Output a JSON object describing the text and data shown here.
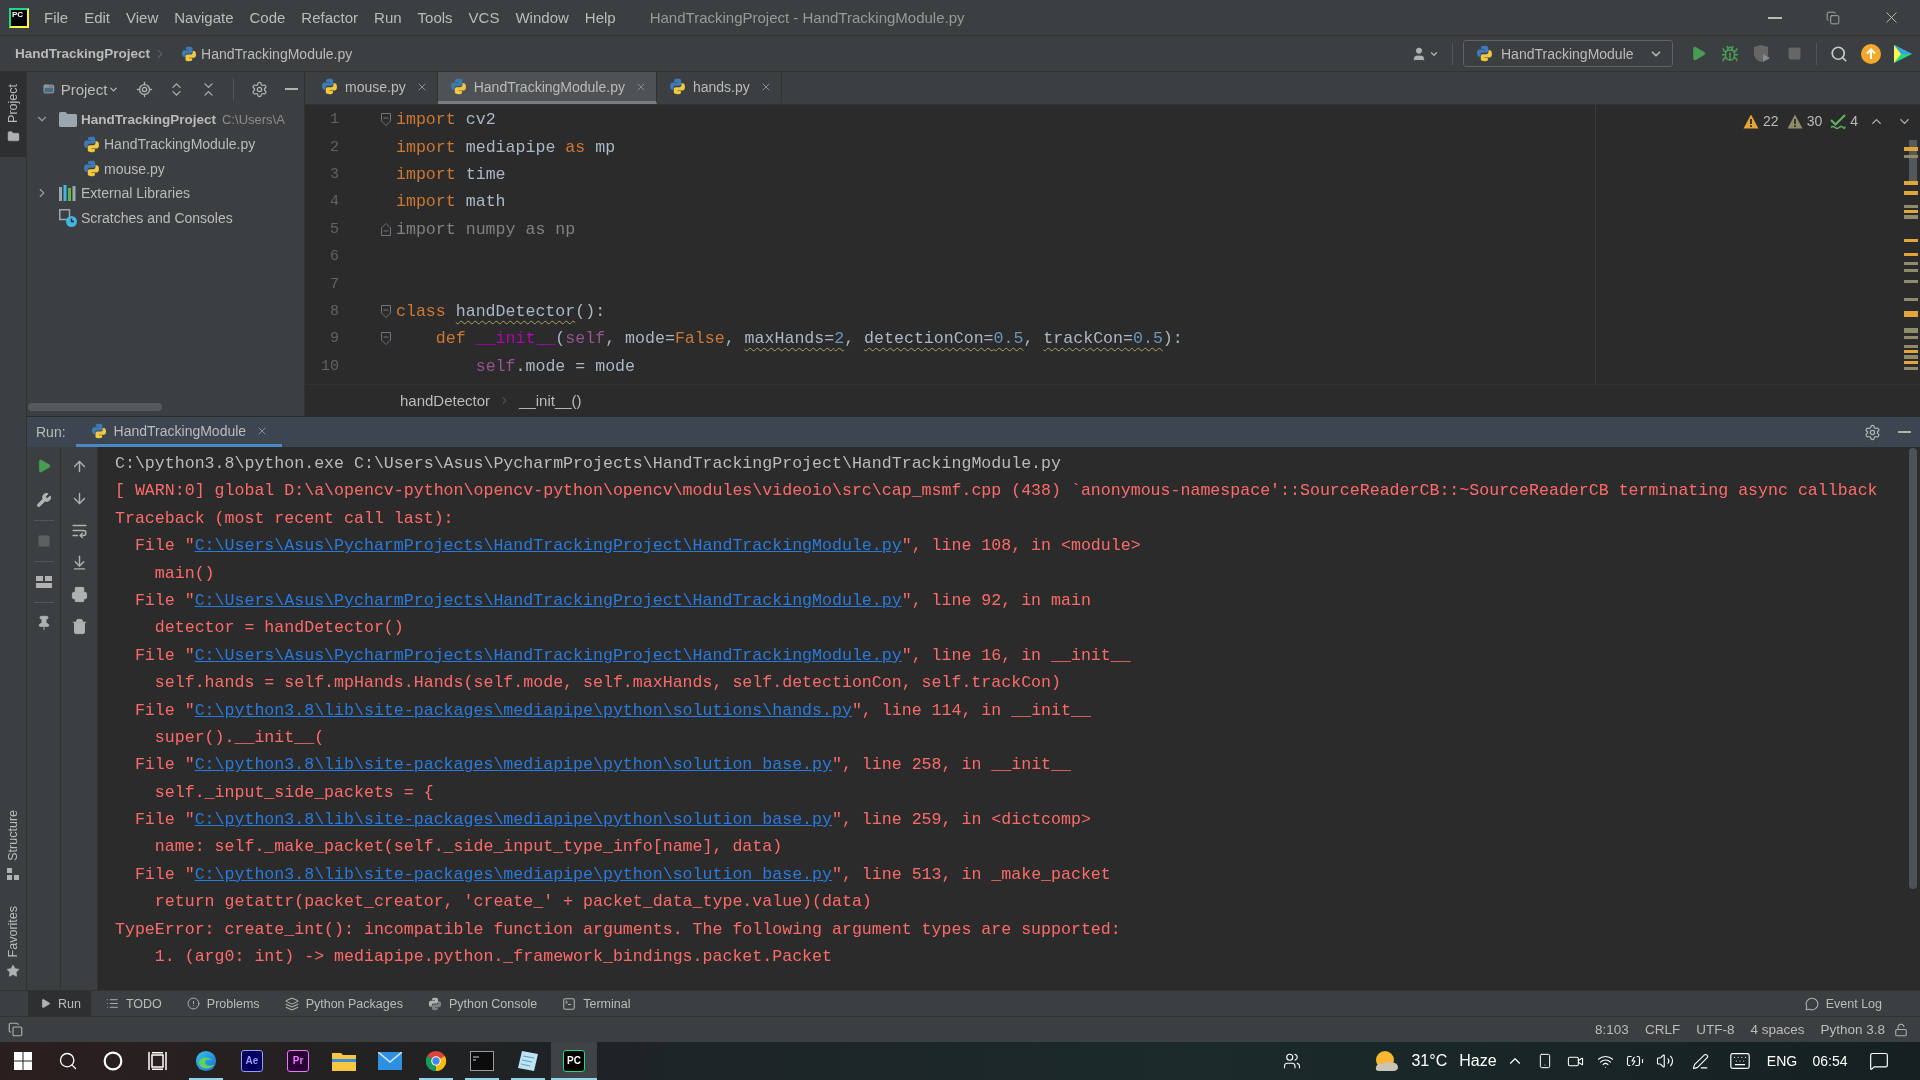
{
  "window": {
    "app_logo": "PC",
    "title": "HandTrackingProject - HandTrackingModule.py"
  },
  "menu": [
    "File",
    "Edit",
    "View",
    "Navigate",
    "Code",
    "Refactor",
    "Run",
    "Tools",
    "VCS",
    "Window",
    "Help"
  ],
  "navigation": {
    "project": "HandTrackingProject",
    "file": "HandTrackingModule.py",
    "run_configuration": "HandTrackingModule"
  },
  "side_strip": {
    "top": [
      {
        "label": "Project",
        "kind": "project",
        "selected": true
      }
    ],
    "bottom": [
      {
        "label": "Structure",
        "kind": "structure",
        "selected": false
      },
      {
        "label": "Favorites",
        "kind": "favorites",
        "selected": false
      }
    ]
  },
  "project_panel": {
    "title": "Project",
    "tree": [
      {
        "name": "HandTrackingProject",
        "path": "C:\\Users\\A",
        "kind": "project",
        "expanded": true,
        "children": [
          {
            "name": "HandTrackingModule.py",
            "kind": "python"
          },
          {
            "name": "mouse.py",
            "kind": "python"
          }
        ]
      },
      {
        "name": "External Libraries",
        "kind": "library",
        "expanded": false
      },
      {
        "name": "Scratches and Consoles",
        "kind": "scratches"
      }
    ]
  },
  "editor_tabs": [
    {
      "label": "mouse.py",
      "selected": false
    },
    {
      "label": "HandTrackingModule.py",
      "selected": true
    },
    {
      "label": "hands.py",
      "selected": false
    }
  ],
  "inspections": [
    {
      "kind": "warning",
      "count": "22"
    },
    {
      "kind": "weak_warning",
      "count": "30"
    },
    {
      "kind": "typo",
      "count": "4"
    }
  ],
  "code": {
    "lines": [
      {
        "number": "1",
        "fold_start": true,
        "fold_end": false,
        "tokens": [
          {
            "text": "import ",
            "kind": "keyword"
          },
          {
            "text": "cv2",
            "kind": "plain"
          }
        ]
      },
      {
        "number": "2",
        "fold_start": false,
        "fold_end": false,
        "tokens": [
          {
            "text": "import ",
            "kind": "keyword"
          },
          {
            "text": "mediapipe ",
            "kind": "plain"
          },
          {
            "text": "as ",
            "kind": "keyword"
          },
          {
            "text": "mp",
            "kind": "plain"
          }
        ]
      },
      {
        "number": "3",
        "fold_start": false,
        "fold_end": false,
        "tokens": [
          {
            "text": "import ",
            "kind": "keyword"
          },
          {
            "text": "time",
            "kind": "plain"
          }
        ]
      },
      {
        "number": "4",
        "fold_start": false,
        "fold_end": false,
        "tokens": [
          {
            "text": "import ",
            "kind": "keyword"
          },
          {
            "text": "math",
            "kind": "plain"
          }
        ]
      },
      {
        "number": "5",
        "fold_start": false,
        "fold_end": true,
        "tokens": [
          {
            "text": "import numpy as np",
            "kind": "unused"
          }
        ]
      },
      {
        "number": "6",
        "fold_start": false,
        "fold_end": false
      },
      {
        "number": "7",
        "fold_start": false,
        "fold_end": false
      },
      {
        "number": "8",
        "fold_start": true,
        "fold_end": false,
        "tokens": [
          {
            "text": "class ",
            "kind": "keyword"
          },
          {
            "text": "handDetector",
            "kind": "warned"
          },
          {
            "text": "():",
            "kind": "plain"
          }
        ],
        "children": [
          {
            "number": "9",
            "fold_start": true,
            "fold_end": false,
            "tokens": [
              {
                "text": "def ",
                "kind": "keyword"
              },
              {
                "text": "__init__",
                "kind": "magic"
              },
              {
                "text": "(",
                "kind": "plain"
              },
              {
                "text": "self",
                "kind": "self"
              },
              {
                "text": ", mode=",
                "kind": "plain"
              },
              {
                "text": "False",
                "kind": "keyword"
              },
              {
                "text": ", ",
                "kind": "plain"
              },
              {
                "text": "maxHands=",
                "kind": "warned"
              },
              {
                "text": "2",
                "kind": "warned_number"
              },
              {
                "text": ", ",
                "kind": "plain"
              },
              {
                "text": "detectionCon=",
                "kind": "warned"
              },
              {
                "text": "0.5",
                "kind": "warned_number"
              },
              {
                "text": ", ",
                "kind": "plain"
              },
              {
                "text": "trackCon=",
                "kind": "warned"
              },
              {
                "text": "0.5",
                "kind": "warned_number"
              },
              {
                "text": "):",
                "kind": "plain"
              }
            ],
            "children": [
              {
                "number": "10",
                "fold_start": false,
                "fold_end": false,
                "tokens": [
                  {
                    "text": "self",
                    "kind": "self"
                  },
                  {
                    "text": ".mode = mode",
                    "kind": "plain"
                  }
                ]
              }
            ]
          }
        ]
      }
    ]
  },
  "editor_breadcrumb": [
    "handDetector",
    "__init__()"
  ],
  "run_panel": {
    "label": "Run:",
    "tabs": [
      {
        "label": "HandTrackingModule",
        "selected": true
      }
    ],
    "console": [
      {
        "kind": "command",
        "text": "C:\\python3.8\\python.exe C:\\Users\\Asus\\PycharmProjects\\HandTrackingProject\\HandTrackingModule.py"
      },
      {
        "kind": "error",
        "text": "[ WARN:0] global D:\\a\\opencv-python\\opencv-python\\opencv\\modules\\videoio\\src\\cap_msmf.cpp (438) `anonymous-namespace'::SourceReaderCB::~SourceReaderCB terminating async callback"
      },
      {
        "kind": "error",
        "text": "Traceback (most recent call last):"
      },
      {
        "kind": "frame",
        "before": "File \"",
        "link": "C:\\Users\\Asus\\PycharmProjects\\HandTrackingProject\\HandTrackingModule.py",
        "after": "\", line 108, in <module>"
      },
      {
        "kind": "source",
        "text": "main()"
      },
      {
        "kind": "frame",
        "before": "File \"",
        "link": "C:\\Users\\Asus\\PycharmProjects\\HandTrackingProject\\HandTrackingModule.py",
        "after": "\", line 92, in main"
      },
      {
        "kind": "source",
        "text": "detector = handDetector()"
      },
      {
        "kind": "frame",
        "before": "File \"",
        "link": "C:\\Users\\Asus\\PycharmProjects\\HandTrackingProject\\HandTrackingModule.py",
        "after": "\", line 16, in __init__"
      },
      {
        "kind": "source",
        "text": "self.hands = self.mpHands.Hands(self.mode, self.maxHands, self.detectionCon, self.trackCon)"
      },
      {
        "kind": "frame",
        "before": "File \"",
        "link": "C:\\python3.8\\lib\\site-packages\\mediapipe\\python\\solutions\\hands.py",
        "after": "\", line 114, in __init__"
      },
      {
        "kind": "source",
        "text": "super().__init__("
      },
      {
        "kind": "frame",
        "before": "File \"",
        "link": "C:\\python3.8\\lib\\site-packages\\mediapipe\\python\\solution_base.py",
        "after": "\", line 258, in __init__"
      },
      {
        "kind": "source",
        "text": "self._input_side_packets = {"
      },
      {
        "kind": "frame",
        "before": "File \"",
        "link": "C:\\python3.8\\lib\\site-packages\\mediapipe\\python\\solution_base.py",
        "after": "\", line 259, in <dictcomp>"
      },
      {
        "kind": "source",
        "text": "name: self._make_packet(self._side_input_type_info[name], data)"
      },
      {
        "kind": "frame",
        "before": "File \"",
        "link": "C:\\python3.8\\lib\\site-packages\\mediapipe\\python\\solution_base.py",
        "after": "\", line 513, in _make_packet"
      },
      {
        "kind": "source",
        "text": "return getattr(packet_creator, 'create_' + packet_data_type.value)(data)"
      },
      {
        "kind": "error",
        "text": "TypeError: create_int(): incompatible function arguments. The following argument types are supported:"
      },
      {
        "kind": "detail",
        "text": "1. (arg0: int) -> mediapipe.python._framework_bindings.packet.Packet"
      }
    ]
  },
  "tool_window_bar": {
    "items": [
      {
        "label": "Run",
        "kind": "run",
        "selected": true
      },
      {
        "label": "TODO",
        "kind": "todo",
        "selected": false
      },
      {
        "label": "Problems",
        "kind": "problems",
        "selected": false
      },
      {
        "label": "Python Packages",
        "kind": "packages",
        "selected": false
      },
      {
        "label": "Python Console",
        "kind": "console",
        "selected": false
      },
      {
        "label": "Terminal",
        "kind": "terminal",
        "selected": false
      }
    ],
    "event_log": "Event Log"
  },
  "status_bar": [
    "8:103",
    "CRLF",
    "UTF-8",
    "4 spaces",
    "Python 3.8"
  ],
  "taskbar": {
    "apps": [
      {
        "kind": "edge",
        "running": true,
        "selected": false
      },
      {
        "kind": "after_effects",
        "glyph": "Ae",
        "running": false,
        "selected": false
      },
      {
        "kind": "premiere",
        "glyph": "Pr",
        "running": false,
        "selected": false
      },
      {
        "kind": "explorer",
        "running": false,
        "selected": false
      },
      {
        "kind": "mail",
        "running": false,
        "selected": false
      },
      {
        "kind": "chrome",
        "running": true,
        "selected": false
      },
      {
        "kind": "console",
        "running": true,
        "selected": false
      },
      {
        "kind": "notes",
        "running": true,
        "selected": false
      },
      {
        "kind": "pycharm",
        "glyph": "PC",
        "running": true,
        "selected": true
      }
    ],
    "tray": {
      "weather": {
        "temperature": "31°C",
        "condition": "Haze"
      },
      "language": "ENG",
      "time": "06:54"
    }
  }
}
